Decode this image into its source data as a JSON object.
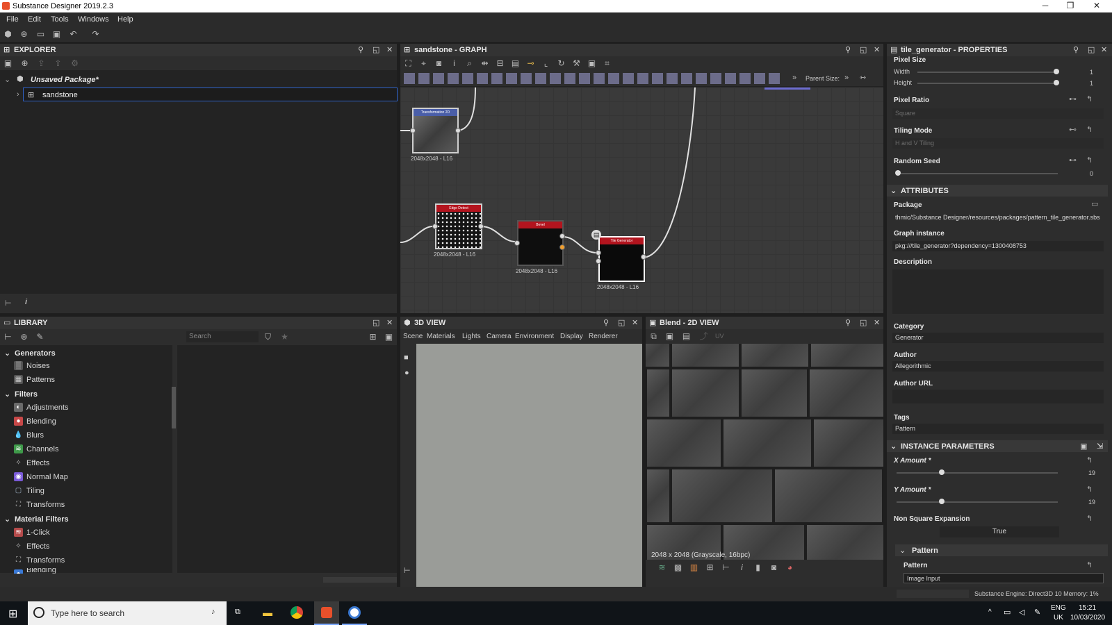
{
  "app": {
    "title": "Substance Designer 2019.2.3"
  },
  "menu": [
    "File",
    "Edit",
    "Tools",
    "Windows",
    "Help"
  ],
  "explorer": {
    "title": "EXPLORER",
    "package": "Unsaved Package*",
    "graph": "sandstone"
  },
  "graph": {
    "title": "sandstone - GRAPH",
    "parent_size": "Parent Size:",
    "nodes": [
      {
        "name": "Transformation 2D",
        "res": "2048x2048 - L16"
      },
      {
        "name": "Edge Detect",
        "res": "2048x2048 - L16"
      },
      {
        "name": "Bevel",
        "res": "2048x2048 - L16"
      },
      {
        "name": "Tile Generator",
        "res": "2048x2048 - L16"
      }
    ]
  },
  "library": {
    "title": "LIBRARY",
    "search_placeholder": "Search",
    "cats": [
      {
        "label": "Generators",
        "items": [
          "Noises",
          "Patterns"
        ]
      },
      {
        "label": "Filters",
        "items": [
          "Adjustments",
          "Blending",
          "Blurs",
          "Channels",
          "Effects",
          "Normal Map",
          "Tiling",
          "Transforms"
        ]
      },
      {
        "label": "Material Filters",
        "items": [
          "1-Click",
          "Effects",
          "Transforms",
          "Blending"
        ]
      }
    ]
  },
  "view3d": {
    "title": "3D VIEW",
    "menu": [
      "Scene",
      "Materials",
      "Lights",
      "Camera",
      "Environment",
      "Display",
      "Renderer"
    ]
  },
  "view2d": {
    "title": "Blend - 2D VIEW",
    "uv": "UV",
    "info": "2048 x 2048 (Grayscale, 16bpc)"
  },
  "props": {
    "title": "tile_generator - PROPERTIES",
    "pixel_size": "Pixel Size",
    "width": "Width",
    "height": "Height",
    "width_val": "1",
    "height_val": "1",
    "pixel_ratio": "Pixel Ratio",
    "pixel_ratio_val": "Square",
    "tiling_mode": "Tiling Mode",
    "tiling_mode_val": "H and V Tiling",
    "random_seed": "Random Seed",
    "random_seed_val": "0",
    "attributes": "ATTRIBUTES",
    "package": "Package",
    "package_val": "thmic/Substance Designer/resources/packages/pattern_tile_generator.sbs",
    "graph_instance": "Graph instance",
    "graph_instance_val": "pkg:///tile_generator?dependency=1300408753",
    "description": "Description",
    "category": "Category",
    "category_val": "Generator",
    "author": "Author",
    "author_val": "Allegorithmic",
    "author_url": "Author URL",
    "tags": "Tags",
    "tags_val": "Pattern",
    "instance_params": "INSTANCE PARAMETERS",
    "x_amount": "X Amount *",
    "x_amount_val": "19",
    "y_amount": "Y Amount *",
    "y_amount_val": "19",
    "non_square": "Non Square Expansion",
    "non_square_val": "True",
    "pattern_sect": "Pattern",
    "pattern": "Pattern",
    "pattern_val": "Image Input"
  },
  "status": "Substance Engine: Direct3D 10  Memory: 1%",
  "taskbar": {
    "search": "Type here to search",
    "lang1": "ENG",
    "lang2": "UK",
    "time": "15:21",
    "date": "10/03/2020"
  },
  "colors": {
    "accent": "#2f63c8",
    "node_red": "#b3141e",
    "node_blue": "#4a5ea8"
  }
}
